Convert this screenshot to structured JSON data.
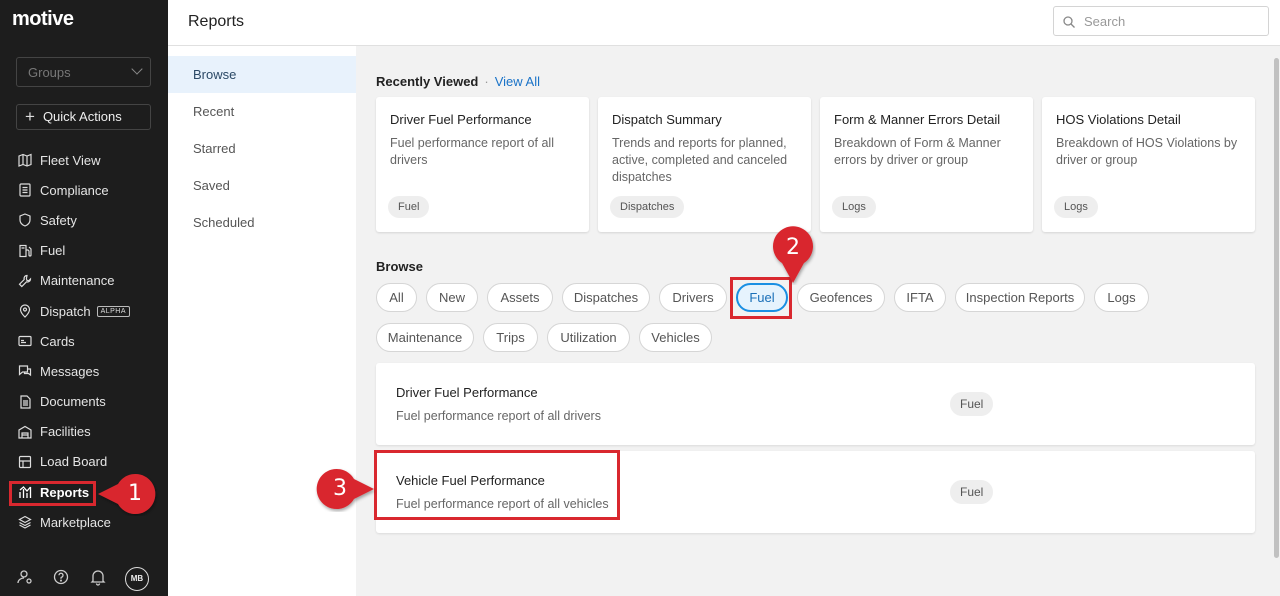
{
  "app": {
    "logo": "motive"
  },
  "sidebar": {
    "groups_placeholder": "Groups",
    "quick_actions": "Quick Actions",
    "items": [
      {
        "label": "Fleet View",
        "icon": "map-icon"
      },
      {
        "label": "Compliance",
        "icon": "list-icon"
      },
      {
        "label": "Safety",
        "icon": "shield-icon"
      },
      {
        "label": "Fuel",
        "icon": "fuel-pump-icon"
      },
      {
        "label": "Maintenance",
        "icon": "wrench-icon"
      },
      {
        "label": "Dispatch",
        "icon": "route-pin-icon",
        "badge": "ALPHA"
      },
      {
        "label": "Cards",
        "icon": "card-icon"
      },
      {
        "label": "Messages",
        "icon": "chat-icon"
      },
      {
        "label": "Documents",
        "icon": "document-icon"
      },
      {
        "label": "Facilities",
        "icon": "building-icon"
      },
      {
        "label": "Load Board",
        "icon": "board-icon"
      },
      {
        "label": "Reports",
        "icon": "chart-icon",
        "active": true
      },
      {
        "label": "Marketplace",
        "icon": "layers-icon"
      }
    ],
    "avatar_initials": "MB"
  },
  "header": {
    "title": "Reports",
    "search_placeholder": "Search"
  },
  "subnav": {
    "items": [
      "Browse",
      "Recent",
      "Starred",
      "Saved",
      "Scheduled"
    ],
    "active": "Browse"
  },
  "recently_viewed": {
    "heading": "Recently Viewed",
    "separator": "·",
    "view_all": "View All",
    "cards": [
      {
        "title": "Driver Fuel Performance",
        "desc": "Fuel performance report of all drivers",
        "tag": "Fuel"
      },
      {
        "title": "Dispatch Summary",
        "desc": "Trends and reports for planned, active, completed and canceled dispatches",
        "tag": "Dispatches"
      },
      {
        "title": "Form & Manner Errors Detail",
        "desc": "Breakdown of Form & Manner errors by driver or group",
        "tag": "Logs"
      },
      {
        "title": "HOS Violations Detail",
        "desc": "Breakdown of HOS Violations by driver or group",
        "tag": "Logs"
      }
    ]
  },
  "browse": {
    "heading": "Browse",
    "chips": [
      "All",
      "New",
      "Assets",
      "Dispatches",
      "Drivers",
      "Fuel",
      "Geofences",
      "IFTA",
      "Inspection Reports",
      "Logs",
      "Maintenance",
      "Trips",
      "Utilization",
      "Vehicles"
    ],
    "selected": "Fuel"
  },
  "results": [
    {
      "title": "Driver Fuel Performance",
      "desc": "Fuel performance report of all drivers",
      "tag": "Fuel"
    },
    {
      "title": "Vehicle Fuel Performance",
      "desc": "Fuel performance report of all vehicles",
      "tag": "Fuel"
    }
  ],
  "callouts": [
    "1",
    "2",
    "3"
  ],
  "colors": {
    "sidebar_bg": "#1d1d1d",
    "accent": "#1a8fe3",
    "callout": "#d9282f",
    "link": "#1a73c8"
  }
}
